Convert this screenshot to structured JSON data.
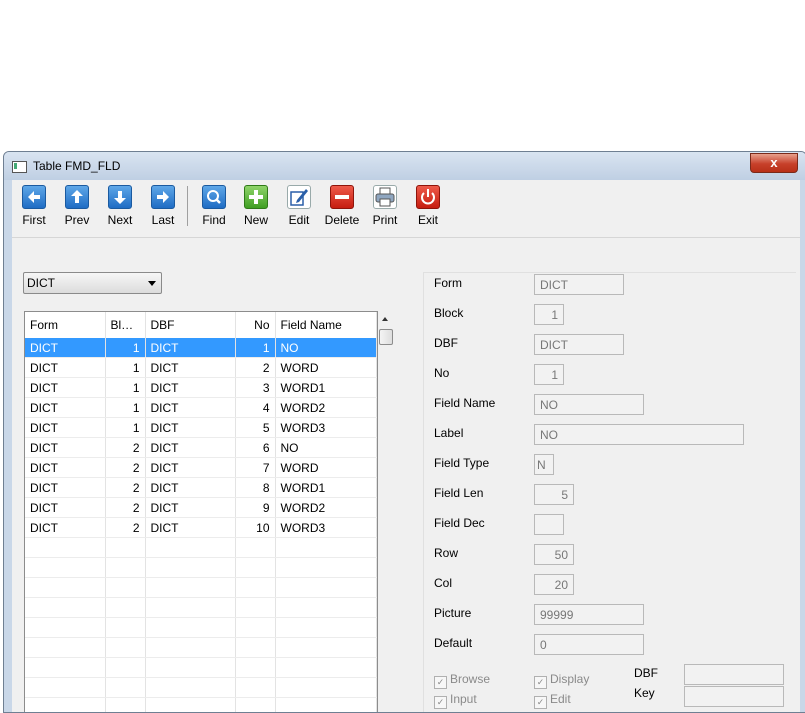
{
  "window": {
    "title": "Table FMD_FLD",
    "close_label": "x"
  },
  "toolbar": {
    "buttons": [
      {
        "label": "First",
        "icon": "arrow-left-icon"
      },
      {
        "label": "Prev",
        "icon": "arrow-up-icon"
      },
      {
        "label": "Next",
        "icon": "arrow-down-icon"
      },
      {
        "label": "Last",
        "icon": "arrow-right-icon"
      },
      {
        "label": "Find",
        "icon": "magnifier-icon"
      },
      {
        "label": "New",
        "icon": "plus-icon"
      },
      {
        "label": "Edit",
        "icon": "pencil-icon"
      },
      {
        "label": "Delete",
        "icon": "minus-icon"
      },
      {
        "label": "Print",
        "icon": "printer-icon"
      },
      {
        "label": "Exit",
        "icon": "power-icon"
      }
    ]
  },
  "form_select": {
    "value": "DICT"
  },
  "grid": {
    "columns": [
      "Form",
      "Bl…",
      "DBF",
      "No",
      "Field Name"
    ],
    "rows": [
      [
        "DICT",
        "1",
        "DICT",
        "1",
        "NO"
      ],
      [
        "DICT",
        "1",
        "DICT",
        "2",
        "WORD"
      ],
      [
        "DICT",
        "1",
        "DICT",
        "3",
        "WORD1"
      ],
      [
        "DICT",
        "1",
        "DICT",
        "4",
        "WORD2"
      ],
      [
        "DICT",
        "1",
        "DICT",
        "5",
        "WORD3"
      ],
      [
        "DICT",
        "2",
        "DICT",
        "6",
        "NO"
      ],
      [
        "DICT",
        "2",
        "DICT",
        "7",
        "WORD"
      ],
      [
        "DICT",
        "2",
        "DICT",
        "8",
        "WORD1"
      ],
      [
        "DICT",
        "2",
        "DICT",
        "9",
        "WORD2"
      ],
      [
        "DICT",
        "2",
        "DICT",
        "10",
        "WORD3"
      ]
    ],
    "selected_row": 0
  },
  "fields": {
    "form": {
      "label": "Form",
      "value": "DICT"
    },
    "block": {
      "label": "Block",
      "value": "1"
    },
    "dbf": {
      "label": "DBF",
      "value": "DICT"
    },
    "no": {
      "label": "No",
      "value": "1"
    },
    "field_name": {
      "label": "Field Name",
      "value": "NO"
    },
    "label": {
      "label": "Label",
      "value": "NO"
    },
    "field_type": {
      "label": "Field Type",
      "value": "N"
    },
    "field_len": {
      "label": "Field Len",
      "value": "5"
    },
    "field_dec": {
      "label": "Field Dec",
      "value": ""
    },
    "row": {
      "label": "Row",
      "value": "50"
    },
    "col": {
      "label": "Col",
      "value": "20"
    },
    "picture": {
      "label": "Picture",
      "value": "99999"
    },
    "default": {
      "label": "Default",
      "value": "0"
    }
  },
  "checkboxes": {
    "browse": {
      "label": "Browse",
      "checked": true
    },
    "display": {
      "label": "Display",
      "checked": true
    },
    "input": {
      "label": "Input",
      "checked": true
    },
    "edit": {
      "label": "Edit",
      "checked": true
    }
  },
  "extra": {
    "dbf_label": "DBF",
    "key_label": "Key",
    "dbf_value": "",
    "key_value": ""
  }
}
